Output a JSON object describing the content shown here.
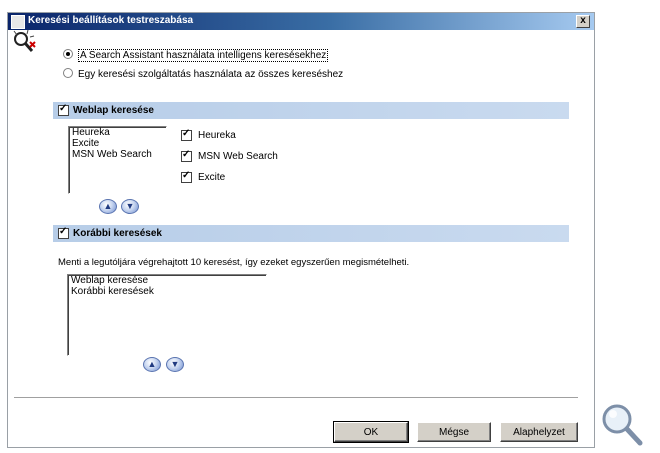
{
  "window": {
    "title": "Keresési beállítások testreszabása",
    "close_glyph": "x"
  },
  "mode": {
    "options": [
      {
        "label": "A Search Assistant használata intelligens keresésekhez",
        "selected": true
      },
      {
        "label": "Egy keresési szolgáltatás használata az összes kereséshez",
        "selected": false
      }
    ]
  },
  "web_search": {
    "header": "Weblap keresése",
    "checked": true,
    "order_list": [
      "Heureka",
      "Excite",
      "MSN Web Search"
    ],
    "providers": [
      {
        "label": "Heureka",
        "checked": true
      },
      {
        "label": "MSN Web Search",
        "checked": true
      },
      {
        "label": "Excite",
        "checked": true
      }
    ],
    "up_icon": "arrow-up-icon",
    "down_icon": "arrow-down-icon"
  },
  "previous_searches": {
    "header": "Korábbi keresések",
    "checked": true,
    "description": "Menti a legutóljára végrehajtott 10 keresést, így ezeket egyszerűen megismételheti.",
    "items": [
      "Weblap keresése",
      "Korábbi keresések"
    ],
    "up_icon": "arrow-up-icon",
    "down_icon": "arrow-down-icon"
  },
  "buttons": {
    "ok": "OK",
    "cancel": "Mégse",
    "reset": "Alaphelyzet"
  },
  "colors": {
    "titlebar_start": "#0a246a",
    "titlebar_end": "#a6caf0",
    "section_bar": "#b7cde8"
  }
}
